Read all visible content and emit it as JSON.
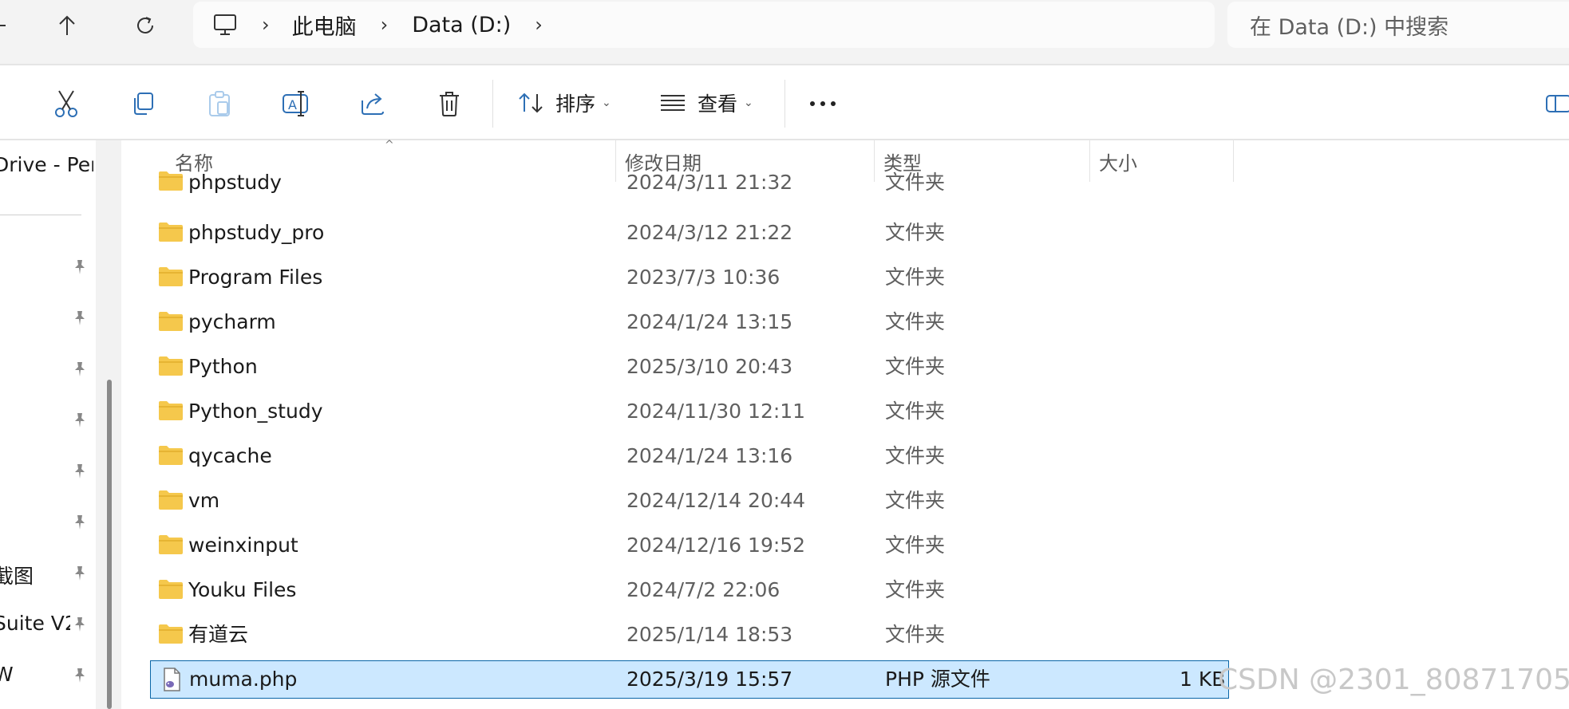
{
  "address_bar": {
    "root_label": "此电脑",
    "drive_label": "Data (D:)"
  },
  "search": {
    "placeholder": "在 Data (D:) 中搜索"
  },
  "toolbar": {
    "sort_label": "排序",
    "view_label": "查看"
  },
  "nav_pane": {
    "items": [
      {
        "label": "Drive - Per"
      },
      {
        "label": ""
      },
      {
        "label": ""
      },
      {
        "label": ""
      },
      {
        "label": ""
      },
      {
        "label": ""
      },
      {
        "label": ""
      },
      {
        "label": "截图"
      },
      {
        "label": "Suite V2"
      },
      {
        "label": "W"
      }
    ]
  },
  "columns": {
    "name": "名称",
    "date": "修改日期",
    "type": "类型",
    "size": "大小"
  },
  "files": [
    {
      "name": "phpstudy",
      "date": "2024/3/11 21:32",
      "type": "文件夹",
      "size": "",
      "icon": "folder-icon"
    },
    {
      "name": "phpstudy_pro",
      "date": "2024/3/12 21:22",
      "type": "文件夹",
      "size": "",
      "icon": "folder-icon"
    },
    {
      "name": "Program Files",
      "date": "2023/7/3 10:36",
      "type": "文件夹",
      "size": "",
      "icon": "folder-icon"
    },
    {
      "name": "pycharm",
      "date": "2024/1/24 13:15",
      "type": "文件夹",
      "size": "",
      "icon": "folder-icon"
    },
    {
      "name": "Python",
      "date": "2025/3/10 20:43",
      "type": "文件夹",
      "size": "",
      "icon": "folder-icon"
    },
    {
      "name": "Python_study",
      "date": "2024/11/30 12:11",
      "type": "文件夹",
      "size": "",
      "icon": "folder-icon"
    },
    {
      "name": "qycache",
      "date": "2024/1/24 13:16",
      "type": "文件夹",
      "size": "",
      "icon": "folder-icon"
    },
    {
      "name": "vm",
      "date": "2024/12/14 20:44",
      "type": "文件夹",
      "size": "",
      "icon": "folder-icon"
    },
    {
      "name": "weinxinput",
      "date": "2024/12/16 19:52",
      "type": "文件夹",
      "size": "",
      "icon": "folder-icon"
    },
    {
      "name": "Youku Files",
      "date": "2024/7/2 22:06",
      "type": "文件夹",
      "size": "",
      "icon": "folder-icon"
    },
    {
      "name": "有道云",
      "date": "2025/1/14 18:53",
      "type": "文件夹",
      "size": "",
      "icon": "folder-icon"
    },
    {
      "name": "muma.php",
      "date": "2025/3/19 15:57",
      "type": "PHP 源文件",
      "size": "1 KB",
      "icon": "php-file-icon",
      "selected": true
    }
  ],
  "watermark": "CSDN @2301_80871705",
  "colors": {
    "accent": "#2d6fb5",
    "selection_bg": "#cce8ff",
    "selection_border": "#0a66a8",
    "folder": "#f5c84c"
  }
}
